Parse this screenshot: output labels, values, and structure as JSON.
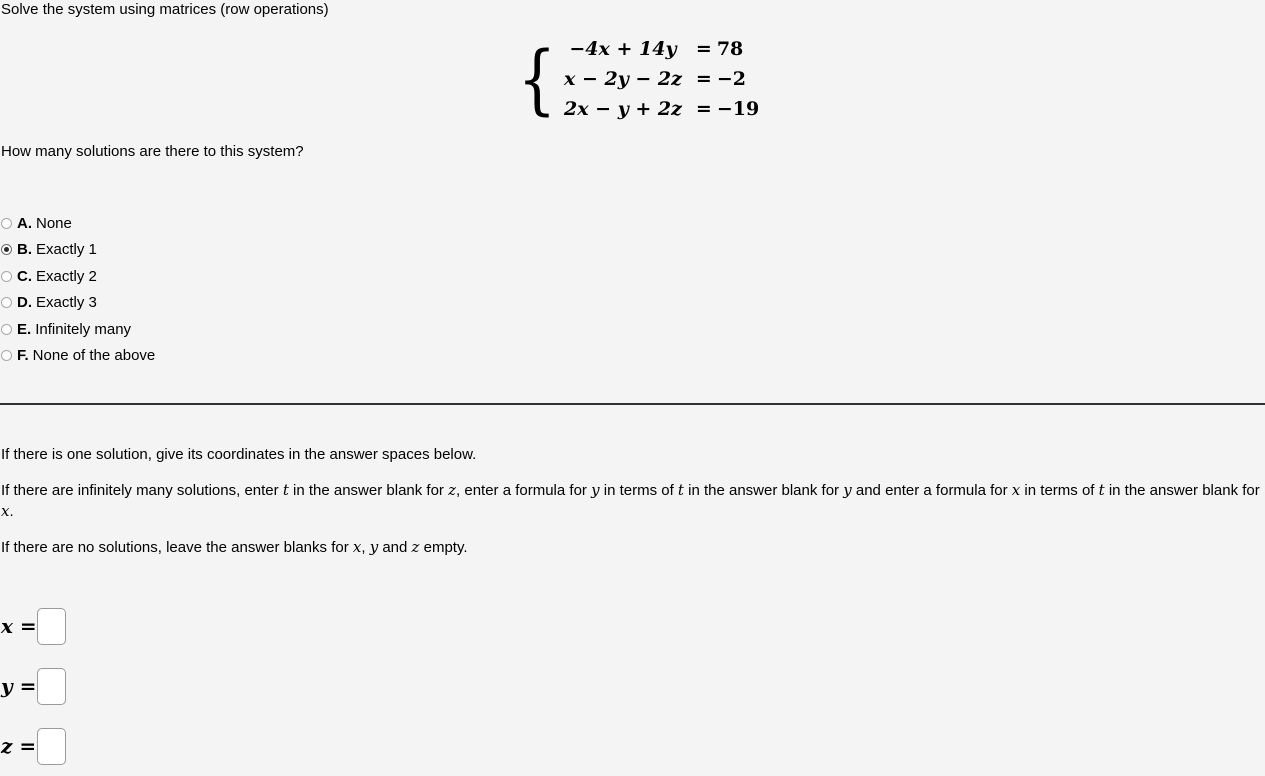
{
  "problem": {
    "heading": "Solve the system using matrices (row operations)",
    "question": "How many solutions are there to this system?"
  },
  "system": {
    "equations": [
      {
        "lhs": "−4x + 14y",
        "rhs": "78",
        "eq": "="
      },
      {
        "lhs": "x − 2y − 2z",
        "rhs": "−2",
        "eq": "="
      },
      {
        "lhs": "2x − y + 2z",
        "rhs": "−19",
        "eq": "="
      }
    ],
    "brace": "{"
  },
  "options": {
    "selected": "B",
    "items": [
      {
        "letter": "A.",
        "label": "None",
        "checked": false
      },
      {
        "letter": "B.",
        "label": "Exactly 1",
        "checked": true
      },
      {
        "letter": "C.",
        "label": "Exactly 2",
        "checked": false
      },
      {
        "letter": "D.",
        "label": "Exactly 3",
        "checked": false
      },
      {
        "letter": "E.",
        "label": "Infinitely many",
        "checked": false
      },
      {
        "letter": "F.",
        "label": "None of the above",
        "checked": false
      }
    ]
  },
  "instructions": {
    "one_solution": "If there is one solution, give its coordinates in the answer spaces below.",
    "infinite_part1": "If there are infinitely many solutions, enter ",
    "infinite_t1": "t",
    "infinite_part2": " in the answer blank for ",
    "infinite_z": "z",
    "infinite_part3": ", enter a formula for ",
    "infinite_y1": "y",
    "infinite_part4": " in terms of ",
    "infinite_t2": "t",
    "infinite_part5": " in the answer blank for ",
    "infinite_y2": "y",
    "infinite_part6": " and enter a formula for ",
    "infinite_x1": "x",
    "infinite_part7": " in terms of ",
    "infinite_t3": "t",
    "infinite_part8": " in the answer blank for ",
    "infinite_x2": "x",
    "infinite_part9": ".",
    "no_solution_part1": "If there are no solutions, leave the answer blanks for ",
    "no_solution_x": "x",
    "no_solution_comma": ", ",
    "no_solution_y": "y",
    "no_solution_and": " and ",
    "no_solution_z": "z",
    "no_solution_part2": " empty."
  },
  "answers": {
    "fields": [
      {
        "var": "x",
        "eq": "=",
        "value": "",
        "placeholder": ""
      },
      {
        "var": "y",
        "eq": "=",
        "value": "",
        "placeholder": ""
      },
      {
        "var": "z",
        "eq": "=",
        "value": "",
        "placeholder": ""
      }
    ]
  },
  "colors": {
    "background": "#f4f4f4",
    "text": "#000000",
    "divider": "#2e3138",
    "input_border": "#9a9a9a",
    "radio_border": "#a8a8a8",
    "radio_dot": "#2b2b2b"
  }
}
